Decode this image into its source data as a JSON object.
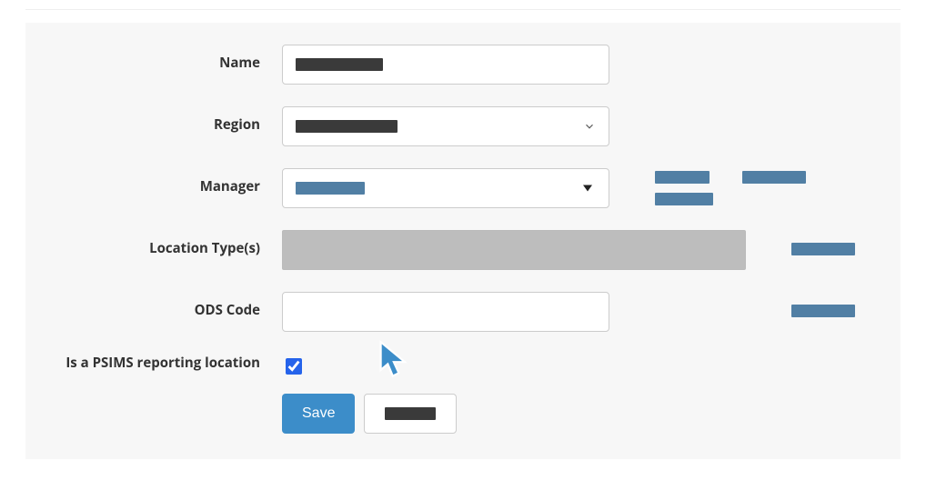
{
  "labels": {
    "name": "Name",
    "region": "Region",
    "manager": "Manager",
    "location_type": "Location Type(s)",
    "ods_code": "ODS Code",
    "psims": "Is a PSIMS reporting location"
  },
  "values": {
    "name": "",
    "region": "",
    "manager": "",
    "location_type": "",
    "ods_code": "",
    "psims_checked": true
  },
  "buttons": {
    "save": "Save",
    "cancel": ""
  },
  "side_actions": {
    "manager_a": "",
    "manager_b": "",
    "manager_c": "",
    "location_type_action": "",
    "ods_action": ""
  }
}
